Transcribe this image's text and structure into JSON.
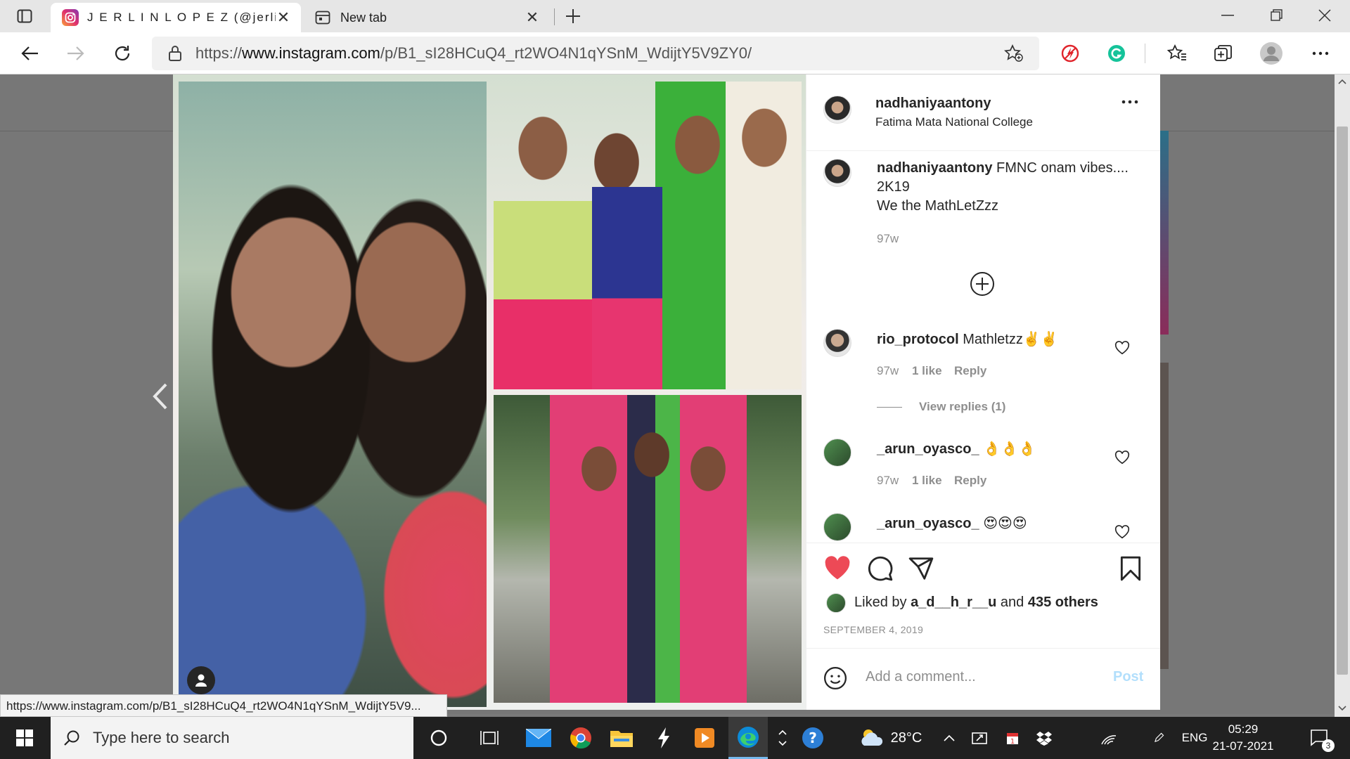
{
  "browser": {
    "tabs": [
      {
        "title": "J E R L I N L O P E Z (@jerlin_lopez",
        "favicon": "instagram-icon",
        "active": true
      },
      {
        "title": "New tab",
        "favicon": "new-tab-page-icon",
        "active": false
      }
    ],
    "url_prefix": "https://",
    "url_host": "www.instagram.com",
    "url_path": "/p/B1_sI28HCuQ4_rt2WO4N1qYSnM_WdijtY5V9ZY0/",
    "status_url": "https://www.instagram.com/p/B1_sI28HCuQ4_rt2WO4N1qYSnM_WdijtY5V9..."
  },
  "post": {
    "author": "nadhaniyaantony",
    "location": "Fatima Mata National College",
    "caption_user": "nadhaniyaantony",
    "caption_line1": "FMNC onam vibes....",
    "caption_line2": "2K19",
    "caption_line3": "We the MathLetZzz",
    "caption_age": "97w",
    "comments": [
      {
        "user": "rio_protocol",
        "text": "Mathletzz✌️✌️",
        "age": "97w",
        "likes": "1 like",
        "reply": "Reply",
        "view_replies": "View replies (1)"
      },
      {
        "user": "_arun_oyasco_",
        "text": "👌👌👌",
        "age": "97w",
        "likes": "1 like",
        "reply": "Reply"
      },
      {
        "user": "_arun_oyasco_",
        "text": "😍😍😍"
      }
    ],
    "liked_prefix": "Liked by",
    "liked_user": "a_d__h_r__u",
    "liked_and": "and",
    "liked_others": "435 others",
    "date": "SEPTEMBER 4, 2019",
    "comment_placeholder": "Add a comment...",
    "post_button": "Post",
    "more_label": "..."
  },
  "taskbar": {
    "search_placeholder": "Type here to search",
    "temperature": "28°C",
    "language": "ENG",
    "time": "05:29",
    "date": "21-07-2021",
    "notification_count": "3"
  },
  "colors": {
    "like_red": "#ed4956",
    "post_blue": "#b2dffc",
    "taskbar": "#202020"
  }
}
